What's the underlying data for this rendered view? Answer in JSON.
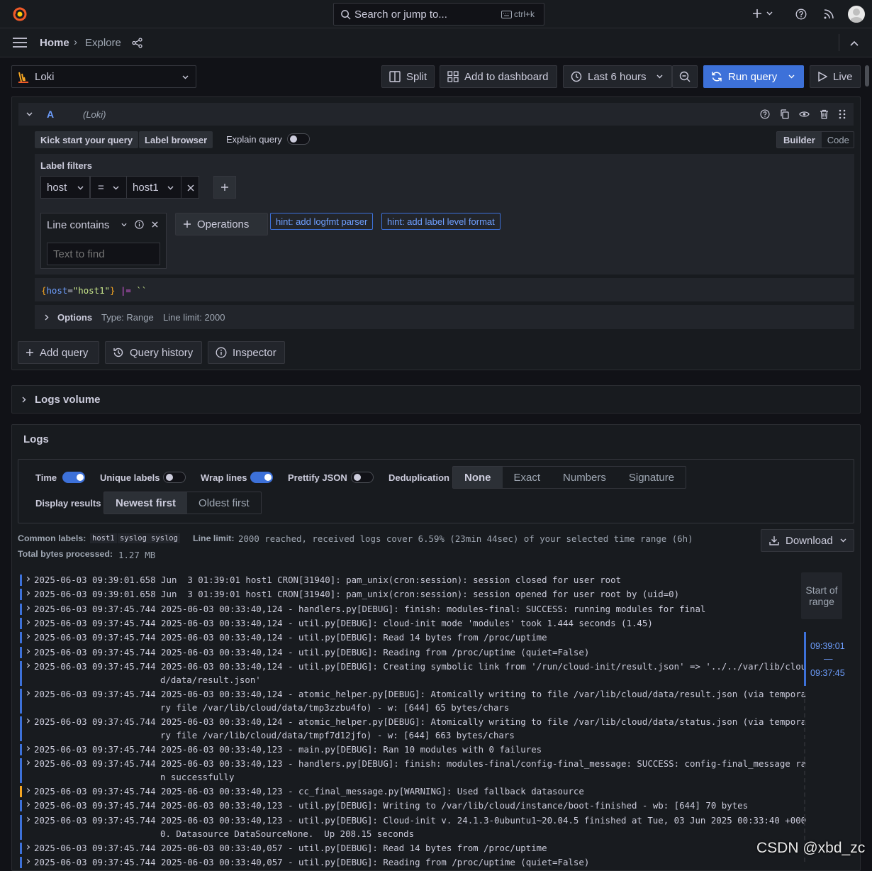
{
  "topbar": {
    "search_placeholder": "Search or jump to...",
    "search_shortcut": "ctrl+k"
  },
  "nav": {
    "breadcrumb_home": "Home",
    "breadcrumb_separator": "›",
    "breadcrumb_current": "Explore"
  },
  "toolbar": {
    "datasource": "Loki",
    "split": "Split",
    "add_to_dashboard": "Add to dashboard",
    "time_range": "Last 6 hours",
    "run_query": "Run query",
    "live": "Live"
  },
  "query": {
    "ref_id": "A",
    "datasource_tag": "(Loki)",
    "kick_start": "Kick start your query",
    "label_browser": "Label browser",
    "explain_query": "Explain query",
    "mode_builder": "Builder",
    "mode_code": "Code",
    "label_filters_title": "Label filters",
    "filter_label": "host",
    "filter_op": "=",
    "filter_value": "host1",
    "operation_name": "Line contains",
    "text_placeholder": "Text to find",
    "operations_btn": "Operations",
    "hint1": "hint: add logfmt parser",
    "hint2": "hint: add label level format",
    "expr_open": "{",
    "expr_key": "host",
    "expr_eq": "=",
    "expr_val": "\"host1\"",
    "expr_close": "}",
    "expr_op": "|=",
    "expr_str": "``",
    "options_label": "Options",
    "options_type": "Type: Range",
    "options_limit": "Line limit: 2000",
    "add_query": "Add query",
    "query_history": "Query history",
    "inspector": "Inspector"
  },
  "logs_volume": {
    "title": "Logs volume"
  },
  "logs": {
    "title": "Logs",
    "time_label": "Time",
    "unique_labels": "Unique labels",
    "wrap_lines": "Wrap lines",
    "prettify_json": "Prettify JSON",
    "dedup_label": "Deduplication",
    "dedup_options": [
      "None",
      "Exact",
      "Numbers",
      "Signature"
    ],
    "display_results": "Display results",
    "order_options": [
      "Newest first",
      "Oldest first"
    ],
    "common_labels_label": "Common labels:",
    "common_labels": [
      "host1",
      "syslog",
      "syslog"
    ],
    "line_limit_label": "Line limit:",
    "line_limit_text": "2000 reached, received logs cover 6.59% (23min 44sec) of your selected time range (6h)",
    "total_bytes_label": "Total bytes processed:",
    "total_bytes": "1.27 MB",
    "download": "Download",
    "nav_start": "Start of range",
    "nav_time_top": "09:39:01",
    "nav_dash": "—",
    "nav_time_bottom": "09:37:45",
    "lines": [
      {
        "level": "info",
        "l1": "2025-06-03 09:39:01.658 Jun  3 01:39:01 host1 CRON[31940]: pam_unix(cron:session): session closed for user root",
        "l2": ""
      },
      {
        "level": "info",
        "l1": "2025-06-03 09:39:01.658 Jun  3 01:39:01 host1 CRON[31940]: pam_unix(cron:session): session opened for user root by (uid=0)",
        "l2": ""
      },
      {
        "level": "info",
        "l1": "2025-06-03 09:37:45.744 2025-06-03 00:33:40,124 - handlers.py[DEBUG]: finish: modules-final: SUCCESS: running modules for final",
        "l2": ""
      },
      {
        "level": "info",
        "l1": "2025-06-03 09:37:45.744 2025-06-03 00:33:40,124 - util.py[DEBUG]: cloud-init mode 'modules' took 1.444 seconds (1.45)",
        "l2": ""
      },
      {
        "level": "info",
        "l1": "2025-06-03 09:37:45.744 2025-06-03 00:33:40,124 - util.py[DEBUG]: Read 14 bytes from /proc/uptime",
        "l2": ""
      },
      {
        "level": "info",
        "l1": "2025-06-03 09:37:45.744 2025-06-03 00:33:40,124 - util.py[DEBUG]: Reading from /proc/uptime (quiet=False)",
        "l2": ""
      },
      {
        "level": "info",
        "l1": "2025-06-03 09:37:45.744 2025-06-03 00:33:40,124 - util.py[DEBUG]: Creating symbolic link from '/run/cloud-init/result.json' => '../../var/lib/clou",
        "l2": "d/data/result.json'"
      },
      {
        "level": "info",
        "l1": "2025-06-03 09:37:45.744 2025-06-03 00:33:40,124 - atomic_helper.py[DEBUG]: Atomically writing to file /var/lib/cloud/data/result.json (via tempora",
        "l2": "ry file /var/lib/cloud/data/tmp3zzbu4fo) - w: [644] 65 bytes/chars"
      },
      {
        "level": "info",
        "l1": "2025-06-03 09:37:45.744 2025-06-03 00:33:40,124 - atomic_helper.py[DEBUG]: Atomically writing to file /var/lib/cloud/data/status.json (via tempora",
        "l2": "ry file /var/lib/cloud/data/tmpf7d12jfo) - w: [644] 663 bytes/chars"
      },
      {
        "level": "info",
        "l1": "2025-06-03 09:37:45.744 2025-06-03 00:33:40,123 - main.py[DEBUG]: Ran 10 modules with 0 failures",
        "l2": ""
      },
      {
        "level": "info",
        "l1": "2025-06-03 09:37:45.744 2025-06-03 00:33:40,123 - handlers.py[DEBUG]: finish: modules-final/config-final_message: SUCCESS: config-final_message ra",
        "l2": "n successfully"
      },
      {
        "level": "warn",
        "l1": "2025-06-03 09:37:45.744 2025-06-03 00:33:40,123 - cc_final_message.py[WARNING]: Used fallback datasource",
        "l2": ""
      },
      {
        "level": "info",
        "l1": "2025-06-03 09:37:45.744 2025-06-03 00:33:40,123 - util.py[DEBUG]: Writing to /var/lib/cloud/instance/boot-finished - wb: [644] 70 bytes",
        "l2": ""
      },
      {
        "level": "info",
        "l1": "2025-06-03 09:37:45.744 2025-06-03 00:33:40,123 - util.py[DEBUG]: Cloud-init v. 24.1.3-0ubuntu1~20.04.5 finished at Tue, 03 Jun 2025 00:33:40 +000",
        "l2": "0. Datasource DataSourceNone.  Up 208.15 seconds"
      },
      {
        "level": "info",
        "l1": "2025-06-03 09:37:45.744 2025-06-03 00:33:40,057 - util.py[DEBUG]: Read 14 bytes from /proc/uptime",
        "l2": ""
      },
      {
        "level": "info",
        "l1": "2025-06-03 09:37:45.744 2025-06-03 00:33:40,057 - util.py[DEBUG]: Reading from /proc/uptime (quiet=False)",
        "l2": ""
      }
    ]
  },
  "watermark": "CSDN @xbd_zc",
  "colors": {
    "accent": "#3d71d9",
    "warn": "#f5a623",
    "grafana_orange": "#f05a28"
  }
}
